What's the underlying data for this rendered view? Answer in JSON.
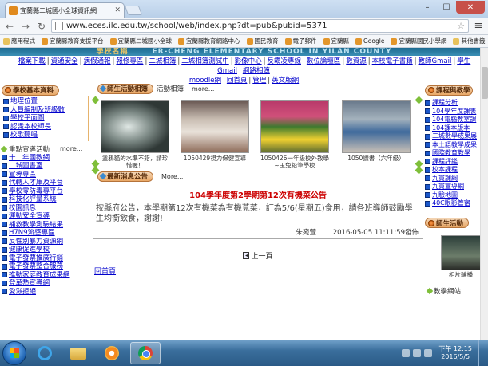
{
  "browser": {
    "tab_title": "宜蘭縣二城國小全球資訊網",
    "url": "www.eces.ilc.edu.tw/school/web/index.php?dt=pub&pubid=5371",
    "bookmarks": [
      "應用程式",
      "宜蘭縣教育支援平台",
      "宜蘭縣二城國小全球",
      "宜蘭縣教育網路中心",
      "國民教育",
      "電子郵件",
      "宜蘭縣",
      "Google",
      "宜蘭縣國民小學網"
    ],
    "other_bookmarks": "其他書籤"
  },
  "site": {
    "banner": "ER-CHENG ELEMENTARY SCHOOL IN YILAN COUNTY",
    "logo_text": "學校名稱",
    "nav": [
      "檔案下載",
      "資通安全",
      "病假通報",
      "報修專區",
      "二城相簿",
      "二城相簿測試中",
      "影像中心",
      "反霸凌專線",
      "數位論壇區",
      "數資源",
      "本校電子書籍",
      "教師Gmail",
      "學生Gmail",
      "網路相簿",
      "moodle網",
      "回首頁",
      "管理",
      "英文版網"
    ]
  },
  "left": {
    "box1_title": "學校基本資料",
    "box1_items": [
      "地理位置",
      "人員編制及班級數",
      "學校平面圖",
      "認識本校師長",
      "校歌聽唱"
    ],
    "box2_title": "重點宣導活動",
    "box2_more": "more...",
    "box2_items": [
      "十二年國教網",
      "二城圖書室",
      "宣導專區",
      "代轉人才庫及平台",
      "學校零防毒專平台",
      "科技化評量系統",
      "校園訊息",
      "運動安全宣導",
      "補救教學測驗結果",
      "H7N9流感專區",
      "反性別暴力資源網",
      "健康促進學校",
      "電子發票推廣行銷",
      "電子發票整合服務",
      "推動家庭教育成果網",
      "登革熱宣導網",
      "愛滋拒絕"
    ]
  },
  "middle": {
    "photos_title": "師生活動相簿",
    "photos_label": "活動相簿",
    "photos_more": "more...",
    "photos": [
      "塗鴉貓的水準不錯，請珍惜喔！",
      "1050429視力保健宣導",
      "1050426一年級校外教學~玉兔鉛筆學校",
      "1050讀書（六年級）"
    ],
    "news_title": "最新消息公告",
    "news_more": "More...",
    "news_headline": "104學年度第2學期第12次有機菜公告",
    "news_body": "按縣府公告，本學期第12次有機菜為有機莧菜，訂為5/6(星期五)食用，請各班導師鼓勵學生均衡飲食，謝謝!",
    "news_author": "朱宛萱",
    "news_date": "2016-05-05 11:11:59發佈",
    "prev_label": "上一頁",
    "home_label": "回首頁"
  },
  "right": {
    "box1_title": "課程與教學",
    "items": [
      "課程分析",
      "104學年度課表",
      "104電腦教室課",
      "104課本版本",
      "二城數學成果展",
      "本土語教學成果",
      "國際教育教學",
      "課程評鑑",
      "校本課程",
      "九貫課綱",
      "九貫宣導網",
      "九驗地圖",
      "40C眼影管宿"
    ],
    "box2_title": "師生活動",
    "thumb_caption": "相片輪播",
    "box3_title": "教學網站"
  },
  "taskbar": {
    "time": "下午 12:15",
    "date": "2016/5/5"
  },
  "colors": {
    "accent_orange": "#e9a866",
    "link_blue": "#0000cc",
    "news_red": "#cc0000"
  }
}
